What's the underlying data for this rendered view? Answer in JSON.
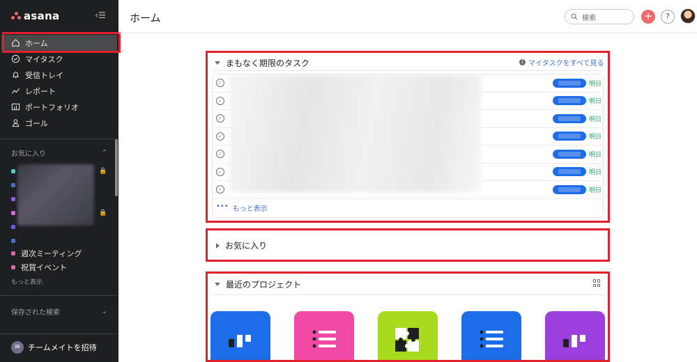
{
  "app": {
    "logo_text": "asana"
  },
  "sidebar": {
    "nav": [
      {
        "label": "ホーム",
        "icon": "home-icon"
      },
      {
        "label": "マイタスク",
        "icon": "check-circle-icon"
      },
      {
        "label": "受信トレイ",
        "icon": "bell-icon"
      },
      {
        "label": "レポート",
        "icon": "chart-line-icon"
      },
      {
        "label": "ポートフォリオ",
        "icon": "portfolio-icon"
      },
      {
        "label": "ゴール",
        "icon": "person-icon"
      }
    ],
    "favorites_title": "お気に入り",
    "favorites_named": [
      {
        "label": "週次ミーティング",
        "color": "#e362a8"
      },
      {
        "label": "祝賀イベント",
        "color": "#e362a8"
      }
    ],
    "favorite_dot_colors": [
      "#4ecbc4",
      "#4573d2",
      "#8d5ce2",
      "#e362e3",
      "#6d5ce8",
      "#4573d2"
    ],
    "show_more": "もっと表示",
    "saved_searches": "保存された検索",
    "invite": "チームメイトを招待"
  },
  "header": {
    "title": "ホーム",
    "search_placeholder": "検索"
  },
  "tasks": {
    "title": "まもなく期限のタスク",
    "see_all": "マイタスクをすべて見る",
    "rows": [
      {
        "due": "明日"
      },
      {
        "due": "明日"
      },
      {
        "due": "明日"
      },
      {
        "due": "明日"
      },
      {
        "due": "明日"
      },
      {
        "due": "明日"
      },
      {
        "due": "明日"
      }
    ],
    "show_more": "もっと表示"
  },
  "favorites_section": {
    "title": "お気に入り"
  },
  "recent": {
    "title": "最近のプロジェクト",
    "tiles": [
      {
        "color": "#1e6de8",
        "icon": "board-icon"
      },
      {
        "color": "#f14aa6",
        "icon": "list-icon"
      },
      {
        "color": "#a8db1e",
        "icon": "puzzle-icon"
      },
      {
        "color": "#1e6de8",
        "icon": "list-icon"
      },
      {
        "color": "#9b3fdd",
        "icon": "board-icon"
      }
    ]
  },
  "colors": {
    "accent": "#f06a6a",
    "highlight": "#e0202a",
    "link": "#4573d2",
    "due": "#29a36a"
  }
}
